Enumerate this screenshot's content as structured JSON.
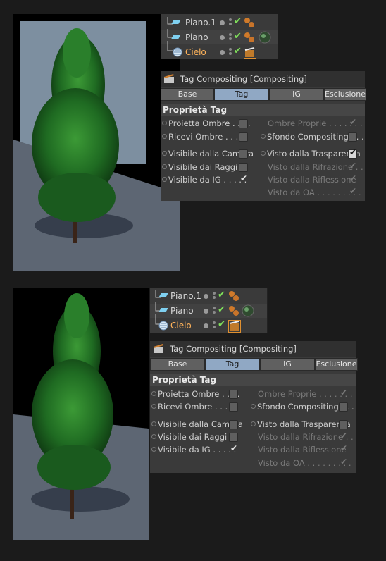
{
  "screens": [
    {
      "objects": [
        {
          "name": "Piano.1",
          "selected": false,
          "tag": "material"
        },
        {
          "name": "Piano",
          "selected": false,
          "tag": "material-sphere"
        },
        {
          "name": "Cielo",
          "selected": true,
          "tag": "compositing"
        }
      ],
      "panel": {
        "title": "Tag Compositing [Compositing]",
        "tabs": [
          "Base",
          "Tag",
          "IG",
          "Esclusione"
        ],
        "active_tab": "Tag",
        "section": "Proprietà Tag",
        "left": [
          {
            "label": "Proietta Ombre . . . .",
            "state": "off"
          },
          {
            "label": "Ricevi Ombre . . . . .",
            "state": "off"
          },
          {
            "label": "Visibile dalla Camera",
            "state": "off"
          },
          {
            "label": "Visibile dai Raggi . .",
            "state": "off"
          },
          {
            "label": "Visibile da IG . . . . .",
            "state": "on"
          }
        ],
        "right": [
          {
            "label": "Ombre Proprie . . . . . . .",
            "state": "disabled"
          },
          {
            "label": "Sfondo Compositing . . .",
            "state": "off"
          },
          {
            "label": "Visto dalla Trasparenza",
            "state": "on"
          },
          {
            "label": "Visto dalla Rifrazione . .",
            "state": "disabled"
          },
          {
            "label": "Visto dalla Riflessione",
            "state": "disabled"
          },
          {
            "label": "Visto da OA . . . . . . . . .",
            "state": "disabled"
          }
        ]
      }
    },
    {
      "objects": [
        {
          "name": "Piano.1",
          "selected": false,
          "tag": "material"
        },
        {
          "name": "Piano",
          "selected": false,
          "tag": "material-sphere"
        },
        {
          "name": "Cielo",
          "selected": true,
          "tag": "compositing"
        }
      ],
      "panel": {
        "title": "Tag Compositing [Compositing]",
        "tabs": [
          "Base",
          "Tag",
          "IG",
          "Esclusione"
        ],
        "active_tab": "Tag",
        "section": "Proprietà Tag",
        "left": [
          {
            "label": "Proietta Ombre . . . .",
            "state": "off"
          },
          {
            "label": "Ricevi Ombre . . . . .",
            "state": "off"
          },
          {
            "label": "Visibile dalla Camera",
            "state": "off"
          },
          {
            "label": "Visibile dai Raggi . .",
            "state": "off"
          },
          {
            "label": "Visibile da IG . . . . .",
            "state": "on"
          }
        ],
        "right": [
          {
            "label": "Ombre Proprie . . . . . . .",
            "state": "disabled"
          },
          {
            "label": "Sfondo Compositing . . .",
            "state": "off"
          },
          {
            "label": "Visto dalla Trasparenza",
            "state": "off"
          },
          {
            "label": "Visto dalla Rifrazione . .",
            "state": "disabled"
          },
          {
            "label": "Visto dalla Riflessione",
            "state": "disabled"
          },
          {
            "label": "Visto da OA . . . . . . . . .",
            "state": "disabled"
          }
        ]
      }
    }
  ],
  "colors": {
    "background": "#1b1b1b",
    "panel": "#3a3a3a",
    "active_tab": "#90a8c4",
    "selected_object": "#ffb35a",
    "check_green": "#7fe05a"
  }
}
